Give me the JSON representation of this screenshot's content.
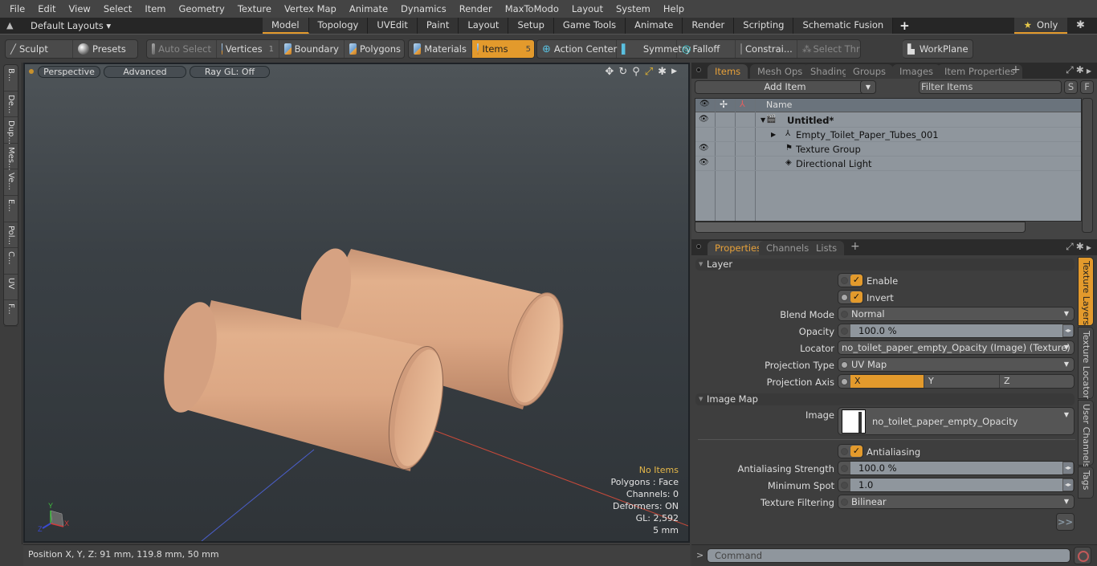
{
  "menu": [
    "File",
    "Edit",
    "View",
    "Select",
    "Item",
    "Geometry",
    "Texture",
    "Vertex Map",
    "Animate",
    "Dynamics",
    "Render",
    "MaxToModo",
    "Layout",
    "System",
    "Help"
  ],
  "layoutbar": {
    "layouts_label": "Default Layouts ▾",
    "tabs": [
      "Model",
      "Topology",
      "UVEdit",
      "Paint",
      "Layout",
      "Setup",
      "Game Tools",
      "Animate",
      "Render",
      "Scripting",
      "Schematic Fusion"
    ],
    "active_tab": "Model",
    "add_tab": "+",
    "only_label": "Only"
  },
  "toolbar": {
    "sculpt": "Sculpt",
    "presets": "Presets",
    "auto_select": "Auto Select",
    "vertices": "Vertices",
    "vertices_count": "1",
    "boundary": "Boundary",
    "polygons": "Polygons",
    "materials": "Materials",
    "items": "Items",
    "items_count": "5",
    "action_center": "Action Center",
    "symmetry": "Symmetry",
    "falloff": "Falloff",
    "constraints": "Constrai...",
    "select_through": "Select Through",
    "workplane": "WorkPlane"
  },
  "left_tabs": [
    "B...",
    "De...",
    "Dup...",
    "Mes...",
    "Ve...",
    "E...",
    "Pol...",
    "C...",
    "UV",
    "F..."
  ],
  "viewport": {
    "view_mode": "Perspective",
    "shading": "Advanced",
    "raygl": "Ray GL: Off",
    "info": {
      "selection": "No Items",
      "polygons": "Polygons : Face",
      "channels": "Channels: 0",
      "deformers": "Deformers: ON",
      "gl": "GL: 2,592",
      "unit": "5 mm"
    },
    "axes": {
      "x": "X",
      "y": "Y",
      "z": "Z"
    }
  },
  "status": {
    "position": "Position X, Y, Z:   91 mm, 119.8 mm, 50 mm"
  },
  "items_panel": {
    "tabs": [
      "Items",
      "Mesh Ops",
      "Shading",
      "Groups",
      "Images",
      "Item Properties"
    ],
    "active_tab": "Items",
    "add_item": "Add Item",
    "filter_placeholder": "Filter Items",
    "s_btn": "S",
    "f_btn": "F",
    "col_name": "Name",
    "rows": [
      {
        "label": "Untitled*",
        "visible": true,
        "bold": true
      },
      {
        "label": "Empty_Toilet_Paper_Tubes_001",
        "visible": false,
        "bold": false
      },
      {
        "label": "Texture Group",
        "visible": true,
        "bold": false
      },
      {
        "label": "Directional Light",
        "visible": true,
        "bold": false
      }
    ]
  },
  "properties_panel": {
    "tabs": [
      "Properties",
      "Channels",
      "Lists"
    ],
    "active_tab": "Properties",
    "side_tabs": [
      "Texture Layers",
      "Texture Locator",
      "User Channels",
      "Tags"
    ],
    "active_side_tab": "Texture Layers",
    "layer_section": "Layer",
    "enable_label": "Enable",
    "enable": true,
    "invert_label": "Invert",
    "invert": true,
    "blend_mode_label": "Blend Mode",
    "blend_mode": "Normal",
    "opacity_label": "Opacity",
    "opacity": "100.0 %",
    "locator_label": "Locator",
    "locator": "no_toilet_paper_empty_Opacity (Image) (Texture)",
    "projection_type_label": "Projection Type",
    "projection_type": "UV Map",
    "projection_axis_label": "Projection Axis",
    "projection_axis_options": [
      "X",
      "Y",
      "Z"
    ],
    "projection_axis": "X",
    "image_map_section": "Image Map",
    "image_label": "Image",
    "image": "no_toilet_paper_empty_Opacity",
    "antialiasing_label": "Antialiasing",
    "antialiasing": true,
    "aa_strength_label": "Antialiasing Strength",
    "aa_strength": "100.0 %",
    "min_spot_label": "Minimum Spot",
    "min_spot": "1.0",
    "tex_filter_label": "Texture Filtering",
    "tex_filter": "Bilinear",
    "more_btn": ">>"
  },
  "command": {
    "prompt": ">",
    "placeholder": "Command"
  },
  "colors": {
    "accent": "#e39a2c",
    "tube": "#dba784",
    "axis_x": "#c84a3a",
    "axis_z": "#4a5ec8"
  }
}
